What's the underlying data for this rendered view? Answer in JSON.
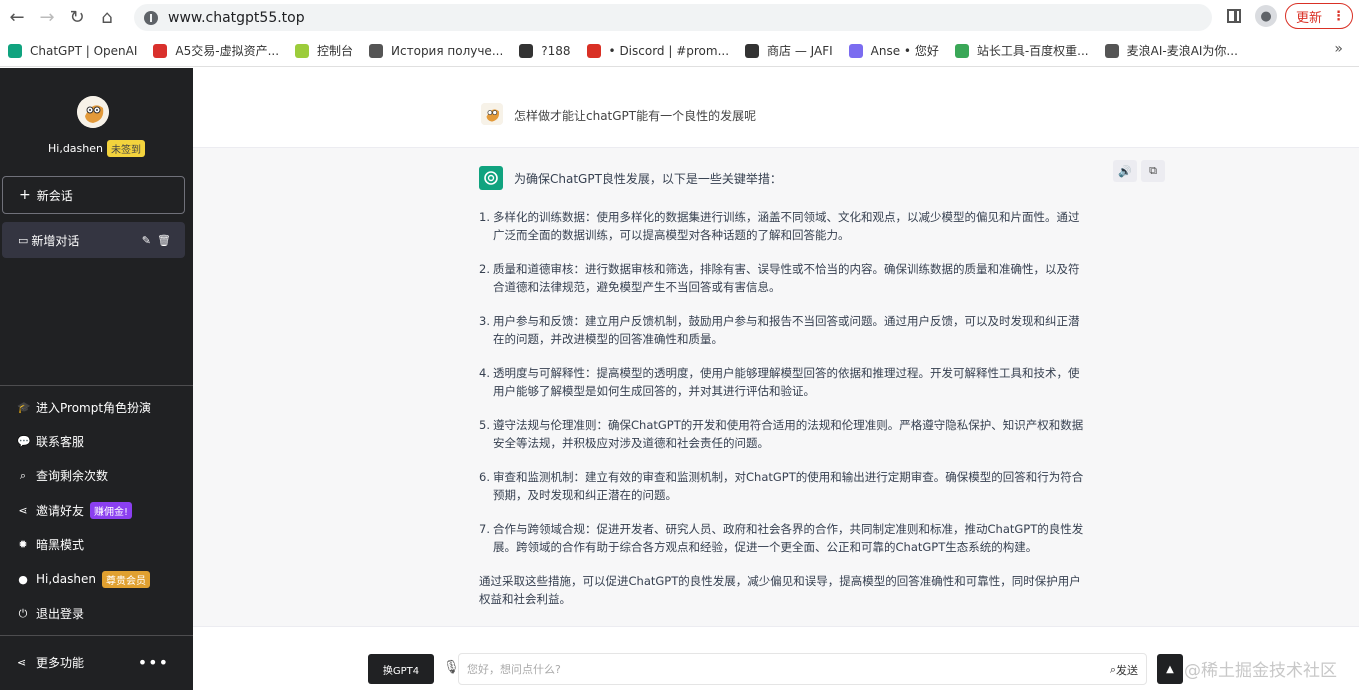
{
  "browser": {
    "url": "www.chatgpt55.top",
    "update_label": "更新",
    "bookmarks": [
      {
        "label": "ChatGPT | OpenAI",
        "color": "#10a37f"
      },
      {
        "label": "A5交易-虚拟资产...",
        "color": "#d9302c"
      },
      {
        "label": "控制台",
        "color": "#9ccc3b"
      },
      {
        "label": "История получе...",
        "color": "#555555"
      },
      {
        "label": "?188",
        "color": "#333333"
      },
      {
        "label": "• Discord | #prom...",
        "color": "#d93025"
      },
      {
        "label": "商店 — JAFI",
        "color": "#333333"
      },
      {
        "label": "Anse • 您好",
        "color": "#7b6cf0"
      },
      {
        "label": "站长工具-百度权重...",
        "color": "#3aa757"
      },
      {
        "label": "麦浪AI-麦浪AI为你...",
        "color": "#555555"
      }
    ]
  },
  "sidebar": {
    "greeting": "Hi,dashen",
    "signin_badge": "未签到",
    "new_chat_label": "新会话",
    "conversation_label": "新增对话",
    "menu": [
      {
        "label": "进入Prompt角色扮演",
        "icon": "graduation-cap-icon",
        "glyph": "🎓"
      },
      {
        "label": "联系客服",
        "icon": "chat-bubbles-icon",
        "glyph": "💬"
      },
      {
        "label": "查询剩余次数",
        "icon": "search-icon",
        "glyph": "⌕"
      },
      {
        "label": "邀请好友",
        "icon": "share-icon",
        "glyph": "⋖",
        "badge": "赚佣金!",
        "badge_style": "purple"
      },
      {
        "label": "暗黑模式",
        "icon": "sun-icon",
        "glyph": "✹"
      },
      {
        "label": "Hi,dashen",
        "icon": "user-icon",
        "glyph": "●",
        "badge": "尊贵会员",
        "badge_style": "orange"
      },
      {
        "label": "退出登录",
        "icon": "power-icon",
        "glyph": "⏻"
      }
    ],
    "more_label": "更多功能"
  },
  "chat": {
    "question": "怎样做才能让chatGPT能有一个良性的发展呢",
    "answer_intro": "为确保ChatGPT良性发展，以下是一些关键举措：",
    "answer_items": [
      {
        "num": "1.",
        "text": "多样化的训练数据：使用多样化的数据集进行训练，涵盖不同领域、文化和观点，以减少模型的偏见和片面性。通过广泛而全面的数据训练，可以提高模型对各种话题的了解和回答能力。"
      },
      {
        "num": "2.",
        "text": "质量和道德审核：进行数据审核和筛选，排除有害、误导性或不恰当的内容。确保训练数据的质量和准确性，以及符合道德和法律规范，避免模型产生不当回答或有害信息。"
      },
      {
        "num": "3.",
        "text": "用户参与和反馈：建立用户反馈机制，鼓励用户参与和报告不当回答或问题。通过用户反馈，可以及时发现和纠正潜在的问题，并改进模型的回答准确性和质量。"
      },
      {
        "num": "4.",
        "text": "透明度与可解释性：提高模型的透明度，使用户能够理解模型回答的依据和推理过程。开发可解释性工具和技术，使用户能够了解模型是如何生成回答的，并对其进行评估和验证。"
      },
      {
        "num": "5.",
        "text": "遵守法规与伦理准则：确保ChatGPT的开发和使用符合适用的法规和伦理准则。严格遵守隐私保护、知识产权和数据安全等法规，并积极应对涉及道德和社会责任的问题。"
      },
      {
        "num": "6.",
        "text": "审查和监测机制：建立有效的审查和监测机制，对ChatGPT的使用和输出进行定期审查。确保模型的回答和行为符合预期，及时发现和纠正潜在的问题。"
      },
      {
        "num": "7.",
        "text": "合作与跨领域合规：促进开发者、研究人员、政府和社会各界的合作，共同制定准则和标准，推动ChatGPT的良性发展。跨领域的合作有助于综合各方观点和经验，促进一个更全面、公正和可靠的ChatGPT生态系统的构建。"
      }
    ],
    "answer_conclusion": "通过采取这些措施，可以促进ChatGPT的良性发展，减少偏见和误导，提高模型的回答准确性和可靠性，同时保护用户权益和社会利益。"
  },
  "input": {
    "gpt4_label": "换GPT4",
    "placeholder": "您好，想问点什么?",
    "send_label": "发送",
    "watermark": "@稀土掘金技术社区"
  },
  "colors": {
    "sidebar_bg": "#202123",
    "accent": "#10a37f"
  }
}
